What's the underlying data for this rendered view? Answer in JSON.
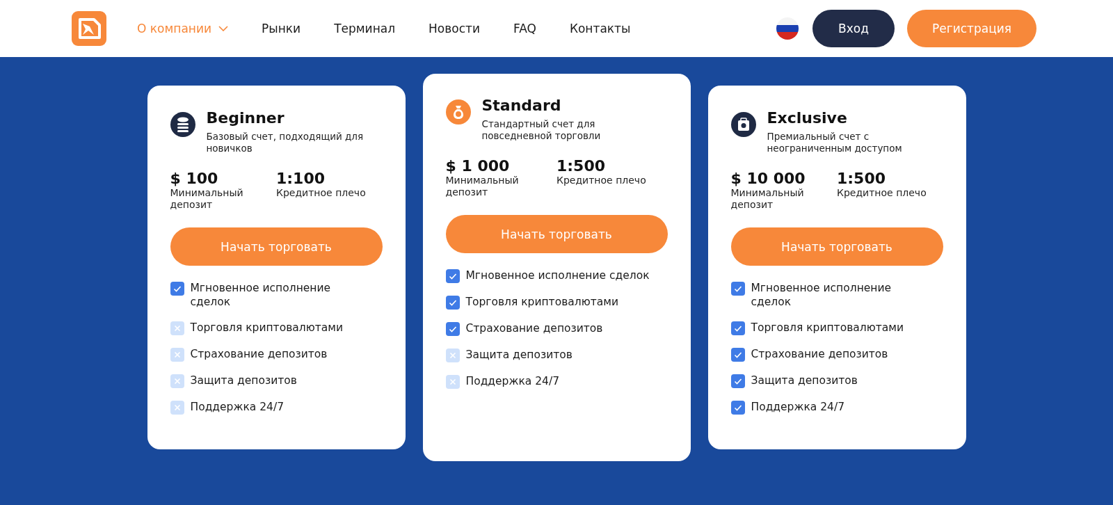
{
  "nav": {
    "items": [
      {
        "label": "О компании",
        "selected": true,
        "dropdown": true
      },
      {
        "label": "Рынки",
        "selected": false,
        "dropdown": false
      },
      {
        "label": "Терминал",
        "selected": false,
        "dropdown": false
      },
      {
        "label": "Новости",
        "selected": false,
        "dropdown": false
      },
      {
        "label": "FAQ",
        "selected": false,
        "dropdown": false
      },
      {
        "label": "Контакты",
        "selected": false,
        "dropdown": false
      }
    ],
    "login": "Вход",
    "register": "Регистрация"
  },
  "plans": [
    {
      "name": "Beginner",
      "highlighted": false,
      "description": "Базовый счет, подходящий для новичков",
      "deposit": "$ 100",
      "deposit_label": "Минимальный депозит",
      "leverage": "1:100",
      "leverage_label": "Кредитное плечо",
      "button": "Начать торговать",
      "features": [
        {
          "label": "Мгновенное исполнение сделок",
          "checked": true
        },
        {
          "label": "Торговля криптовалютами",
          "checked": false
        },
        {
          "label": "Страхование депозитов",
          "checked": false
        },
        {
          "label": "Защита депозитов",
          "checked": false
        },
        {
          "label": "Поддержка 24/7",
          "checked": false
        }
      ]
    },
    {
      "name": "Standard",
      "highlighted": true,
      "description": "Стандартный счет для повседневной торговли",
      "deposit": "$ 1 000",
      "deposit_label": "Минимальный депозит",
      "leverage": "1:500",
      "leverage_label": "Кредитное плечо",
      "button": "Начать торговать",
      "features": [
        {
          "label": "Мгновенное исполнение сделок",
          "checked": true
        },
        {
          "label": "Торговля криптовалютами",
          "checked": true
        },
        {
          "label": "Страхование депозитов",
          "checked": true
        },
        {
          "label": "Защита депозитов",
          "checked": false
        },
        {
          "label": "Поддержка 24/7",
          "checked": false
        }
      ]
    },
    {
      "name": "Exclusive",
      "highlighted": false,
      "description": "Премиальный счет с неограниченным доступом",
      "deposit": "$ 10 000",
      "deposit_label": "Минимальный депозит",
      "leverage": "1:500",
      "leverage_label": "Кредитное плечо",
      "button": "Начать торговать",
      "features": [
        {
          "label": "Мгновенное исполнение сделок",
          "checked": true
        },
        {
          "label": "Торговля криптовалютами",
          "checked": true
        },
        {
          "label": "Страхование депозитов",
          "checked": true
        },
        {
          "label": "Защита депозитов",
          "checked": true
        },
        {
          "label": "Поддержка 24/7",
          "checked": true
        }
      ]
    }
  ]
}
